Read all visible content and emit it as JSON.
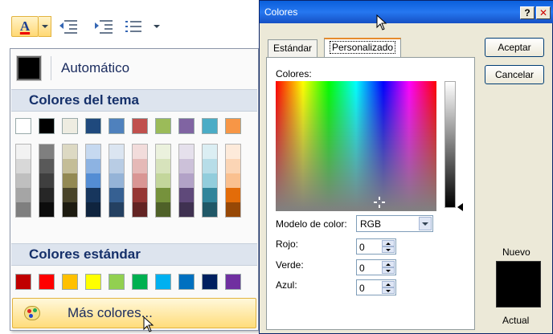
{
  "ribbon": {
    "font_color_glyph": "A"
  },
  "menu": {
    "automatic_label": "Automático",
    "theme_colors_heading": "Colores del tema",
    "standard_colors_heading": "Colores estándar",
    "more_colors_label": "Más colores...",
    "theme_top_row": [
      "#ffffff",
      "#000000",
      "#eeece1",
      "#1f497d",
      "#4f81bd",
      "#c0504d",
      "#9bbb59",
      "#8064a2",
      "#4bacc6",
      "#f79646"
    ],
    "theme_shades": [
      [
        "#f2f2f2",
        "#d8d8d8",
        "#bfbfbf",
        "#a5a5a5",
        "#7f7f7f"
      ],
      [
        "#7f7f7f",
        "#595959",
        "#3f3f3f",
        "#262626",
        "#0c0c0c"
      ],
      [
        "#ddd9c3",
        "#c4bd97",
        "#938953",
        "#494429",
        "#1d1b10"
      ],
      [
        "#c6d9f0",
        "#8db3e2",
        "#548dd4",
        "#17365d",
        "#0f243e"
      ],
      [
        "#dbe5f1",
        "#b8cce4",
        "#95b3d7",
        "#366092",
        "#244061"
      ],
      [
        "#f2dcdb",
        "#e5b9b7",
        "#d99694",
        "#953734",
        "#632423"
      ],
      [
        "#ebf1dd",
        "#d7e3bc",
        "#c3d69b",
        "#76923c",
        "#4f6128"
      ],
      [
        "#e5e0ec",
        "#ccc1d9",
        "#b2a2c7",
        "#5f497a",
        "#3f3151"
      ],
      [
        "#dbeef3",
        "#b7dde8",
        "#92cddc",
        "#31859b",
        "#205867"
      ],
      [
        "#fdeada",
        "#fbd5b5",
        "#fac08f",
        "#e36c09",
        "#974806"
      ]
    ],
    "standard_colors": [
      "#c00000",
      "#ff0000",
      "#ffc000",
      "#ffff00",
      "#92d050",
      "#00b050",
      "#00b0f0",
      "#0070c0",
      "#002060",
      "#7030a0"
    ]
  },
  "dialog": {
    "title": "Colores",
    "help_label": "?",
    "close_label": "✕",
    "tabs": [
      "Estándar",
      "Personalizado"
    ],
    "colors_label": "Colores:",
    "model_label": "Modelo de color:",
    "model_value": "RGB",
    "red_label": "Rojo:",
    "red_value": "0",
    "green_label": "Verde:",
    "green_value": "0",
    "blue_label": "Azul:",
    "blue_value": "0",
    "ok_label": "Aceptar",
    "cancel_label": "Cancelar",
    "new_label": "Nuevo",
    "current_label": "Actual",
    "preview_color": "#000000"
  }
}
